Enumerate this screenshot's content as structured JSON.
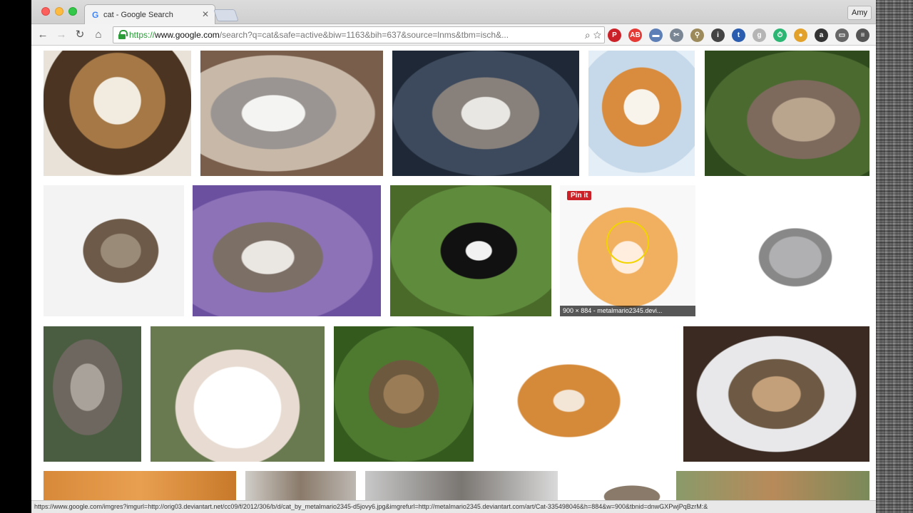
{
  "window": {
    "tab_title": "cat - Google Search",
    "tab_favicon": "G",
    "profile_name": "Amy"
  },
  "toolbar": {
    "url_scheme": "https://",
    "url_host": "www.google.com",
    "url_path": "/search?q=cat&safe=active&biw=1163&bih=637&source=lnms&tbm=isch&...",
    "omni_icons": "⌕ ☆",
    "extensions": [
      {
        "name": "pinterest-icon",
        "glyph": "P",
        "color": "#cb2027"
      },
      {
        "name": "adblock-icon",
        "glyph": "AB",
        "color": "#e53935"
      },
      {
        "name": "bookmark-icon",
        "glyph": "▬",
        "color": "#5c7fb8"
      },
      {
        "name": "scissors-icon",
        "glyph": "✂",
        "color": "#7a8694"
      },
      {
        "name": "dropper-icon",
        "glyph": "⚲",
        "color": "#9c8a5a"
      },
      {
        "name": "info-icon",
        "glyph": "i",
        "color": "#444444"
      },
      {
        "name": "twitter-icon",
        "glyph": "t",
        "color": "#2a5db0"
      },
      {
        "name": "ghost-icon",
        "glyph": "g",
        "color": "#b5b5b5"
      },
      {
        "name": "timer-icon",
        "glyph": "⏱",
        "color": "#2bb673"
      },
      {
        "name": "color-wheel-icon",
        "glyph": "●",
        "color": "#e2a12b"
      },
      {
        "name": "amazon-icon",
        "glyph": "a",
        "color": "#333333"
      },
      {
        "name": "cast-icon",
        "glyph": "▭",
        "color": "#666666"
      },
      {
        "name": "menu-icon",
        "glyph": "≡",
        "color": "#555555"
      }
    ]
  },
  "images": {
    "pin_label": "Pin it",
    "hover_caption": "900 × 884 - metalmario2345.devi..."
  },
  "status": {
    "url": "https://www.google.com/imgres?imgurl=http://orig03.deviantart.net/cc09/f/2012/306/b/d/cat_by_metalmario2345-d5jovy6.jpg&imgrefurl=http://metalmario2345.deviantart.com/art/Cat-335498046&h=884&w=900&tbnid=dnwGXPwjPqBzrM:&"
  }
}
